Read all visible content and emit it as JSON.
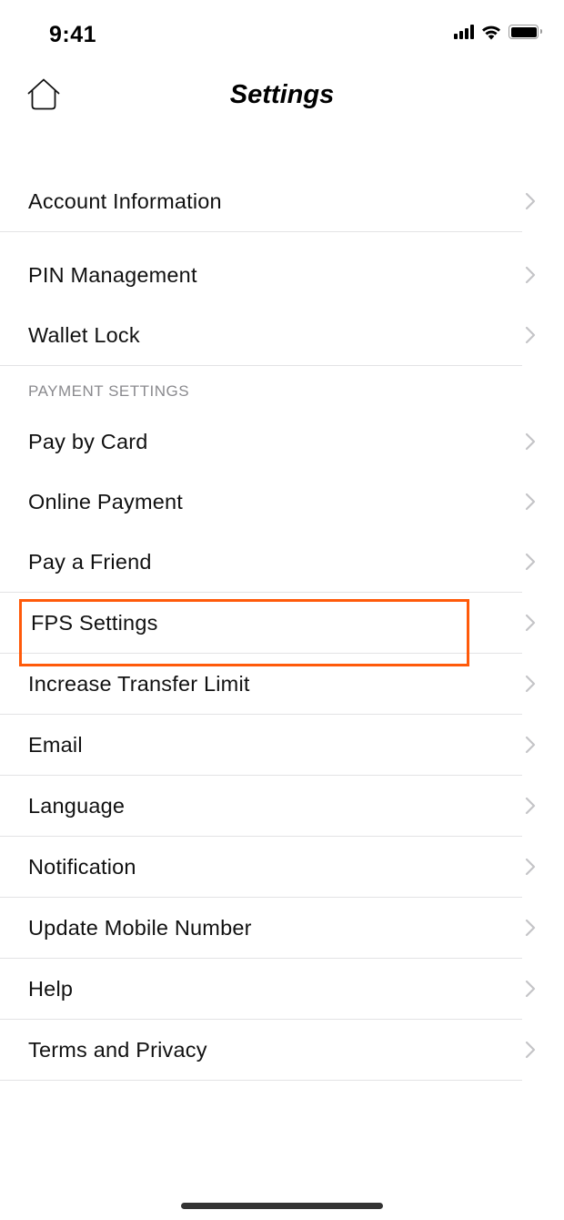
{
  "status_bar": {
    "time": "9:41",
    "icons": [
      "cellular-signal-icon",
      "wifi-icon",
      "battery-icon"
    ]
  },
  "header": {
    "title": "Settings",
    "left_icon": "home-icon"
  },
  "groups": [
    {
      "header": null,
      "items": [
        {
          "label": "Account Information",
          "icon": "chevron-right-icon"
        }
      ]
    },
    {
      "header": null,
      "items": [
        {
          "label": "PIN Management",
          "icon": "chevron-right-icon"
        },
        {
          "label": "Wallet Lock",
          "icon": "chevron-right-icon"
        }
      ]
    },
    {
      "header": "PAYMENT SETTINGS",
      "items": [
        {
          "label": "Pay by Card",
          "icon": "chevron-right-icon"
        },
        {
          "label": "Online Payment",
          "icon": "chevron-right-icon"
        },
        {
          "label": "Pay a Friend",
          "icon": "chevron-right-icon"
        },
        {
          "label": "FPS Settings",
          "icon": "chevron-right-icon",
          "highlighted": true
        },
        {
          "label": "Increase Transfer Limit",
          "icon": "chevron-right-icon"
        },
        {
          "label": "Email",
          "icon": "chevron-right-icon"
        },
        {
          "label": "Language",
          "icon": "chevron-right-icon"
        },
        {
          "label": "Notification",
          "icon": "chevron-right-icon"
        },
        {
          "label": "Update Mobile Number",
          "icon": "chevron-right-icon"
        },
        {
          "label": "Help",
          "icon": "chevron-right-icon"
        },
        {
          "label": "Terms and Privacy",
          "icon": "chevron-right-icon"
        }
      ]
    }
  ],
  "colors": {
    "highlight": "#ff5a0a",
    "divider": "#e3e3e5",
    "section_header": "#8a8a8e",
    "chevron": "#c4c4c7"
  }
}
